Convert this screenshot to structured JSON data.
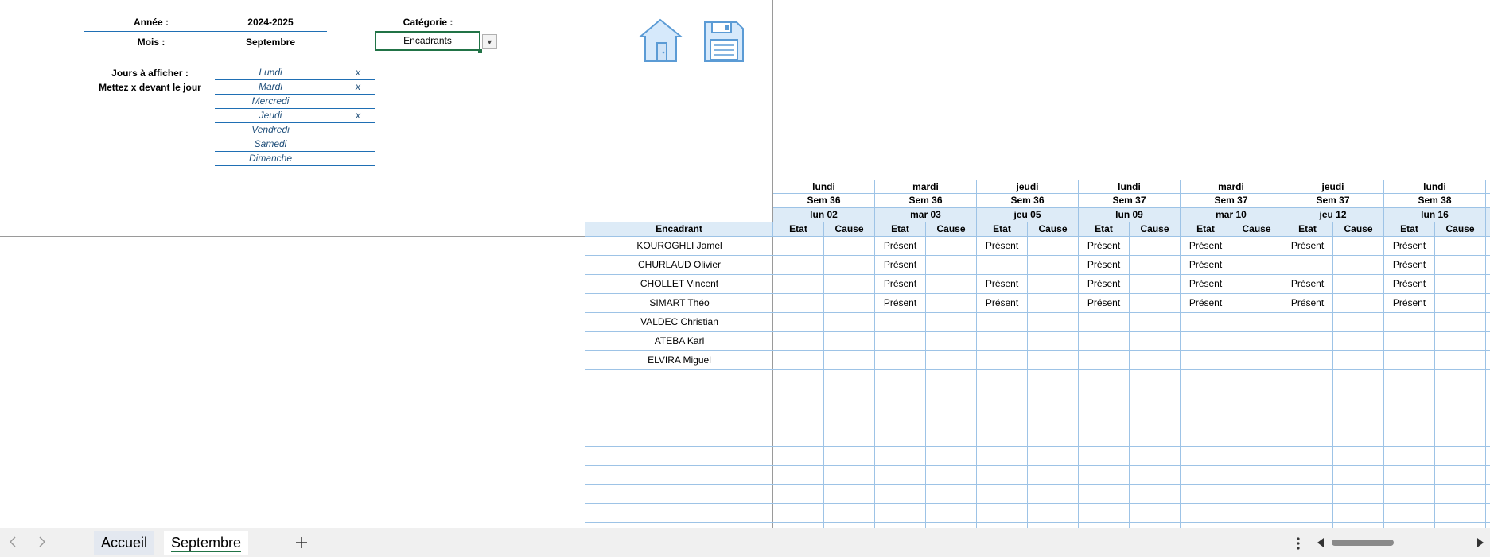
{
  "params": {
    "annee_label": "Année :",
    "annee_value": "2024-2025",
    "mois_label": "Mois :",
    "mois_value": "Septembre",
    "categorie_label": "Catégorie :",
    "categorie_value": "Encadrants",
    "jours_label": "Jours à afficher :",
    "jours_hint": "Mettez x devant le jour",
    "days": [
      {
        "name": "Lundi",
        "mark": "x"
      },
      {
        "name": "Mardi",
        "mark": "x"
      },
      {
        "name": "Mercredi",
        "mark": ""
      },
      {
        "name": "Jeudi",
        "mark": "x"
      },
      {
        "name": "Vendredi",
        "mark": ""
      },
      {
        "name": "Samedi",
        "mark": ""
      },
      {
        "name": "Dimanche",
        "mark": ""
      }
    ]
  },
  "icons": {
    "home": "home-icon",
    "save": "floppy-disk-icon"
  },
  "grid": {
    "name_header": "Encadrant",
    "sub_headers": {
      "etat": "Etat",
      "cause": "Cause"
    },
    "columns": [
      {
        "weekday": "lundi",
        "week": "Sem 36",
        "date": "lun 02"
      },
      {
        "weekday": "mardi",
        "week": "Sem 36",
        "date": "mar 03"
      },
      {
        "weekday": "jeudi",
        "week": "Sem 36",
        "date": "jeu 05"
      },
      {
        "weekday": "lundi",
        "week": "Sem 37",
        "date": "lun 09"
      },
      {
        "weekday": "mardi",
        "week": "Sem 37",
        "date": "mar 10"
      },
      {
        "weekday": "jeudi",
        "week": "Sem 37",
        "date": "jeu 12"
      },
      {
        "weekday": "lundi",
        "week": "Sem 38",
        "date": "lun 16"
      }
    ],
    "rows": [
      {
        "name": "KOUROGHLI Jamel",
        "etat": [
          "",
          "Présent",
          "Présent",
          "Présent",
          "Présent",
          "Présent",
          "Présent"
        ]
      },
      {
        "name": "CHURLAUD Olivier",
        "etat": [
          "",
          "Présent",
          "",
          "Présent",
          "Présent",
          "",
          "Présent"
        ]
      },
      {
        "name": "CHOLLET Vincent",
        "etat": [
          "",
          "Présent",
          "Présent",
          "Présent",
          "Présent",
          "Présent",
          "Présent"
        ]
      },
      {
        "name": "SIMART Théo",
        "etat": [
          "",
          "Présent",
          "Présent",
          "Présent",
          "Présent",
          "Présent",
          "Présent"
        ]
      },
      {
        "name": "VALDEC Christian",
        "etat": [
          "",
          "",
          "",
          "",
          "",
          "",
          ""
        ]
      },
      {
        "name": "ATEBA Karl",
        "etat": [
          "",
          "",
          "",
          "",
          "",
          "",
          ""
        ]
      },
      {
        "name": "ELVIRA Miguel",
        "etat": [
          "",
          "",
          "",
          "",
          "",
          "",
          ""
        ]
      }
    ],
    "empty_rows": 9
  },
  "sheet_tabs": {
    "tabs": [
      {
        "label": "Accueil",
        "active": false
      },
      {
        "label": "Septembre",
        "active": true
      }
    ],
    "add_icon": "plus-icon",
    "prev_icon": "chevron-left-icon",
    "next_icon": "chevron-right-icon",
    "more_icon": "vertical-ellipsis-icon"
  },
  "colors": {
    "accent": "#217346",
    "header_fill": "#ddebf7",
    "grid_line": "#9dc3e6",
    "label_blue": "#1f4e79"
  }
}
